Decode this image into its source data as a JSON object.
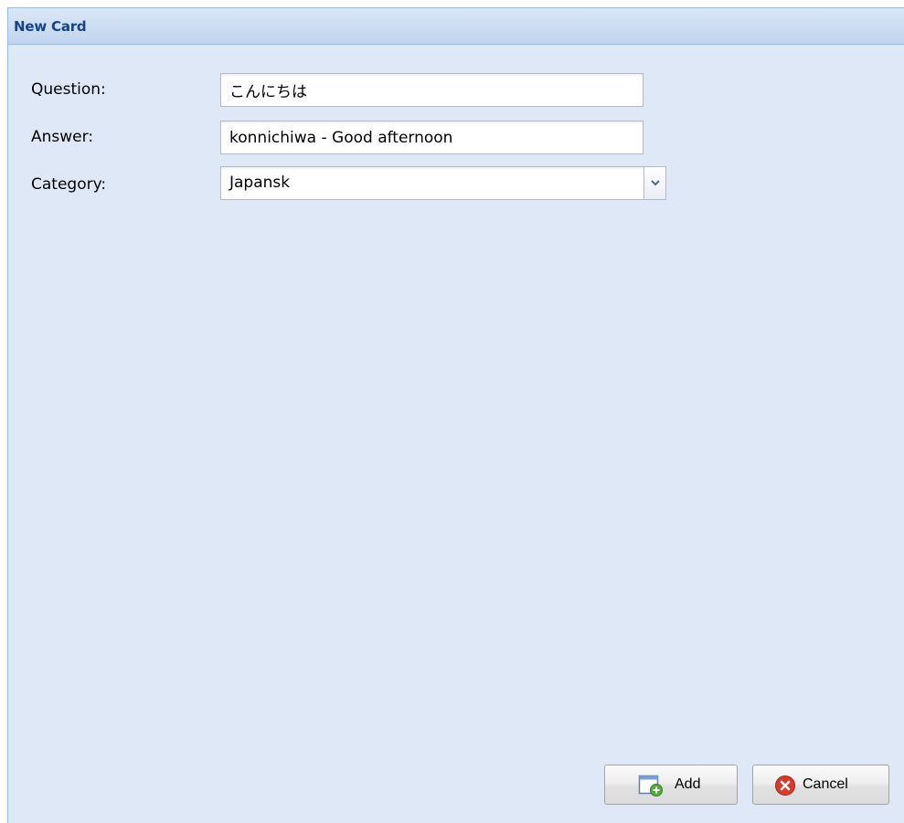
{
  "window": {
    "title": "New Card"
  },
  "form": {
    "question": {
      "label": "Question:",
      "value": "こんにちは"
    },
    "answer": {
      "label": "Answer:",
      "value": "konnichiwa - Good afternoon"
    },
    "category": {
      "label": "Category:",
      "value": "Japansk"
    }
  },
  "buttons": {
    "add_label": "Add",
    "cancel_label": "Cancel"
  },
  "icons": {
    "add": "add-card-icon",
    "cancel": "cancel-icon",
    "dropdown": "chevron-down-icon"
  },
  "colors": {
    "title_text": "#15428b",
    "panel_background": "#dfe8f6",
    "border": "#99bbe8",
    "cancel_icon": "#d83a2e",
    "add_icon": "#4fae3c"
  }
}
